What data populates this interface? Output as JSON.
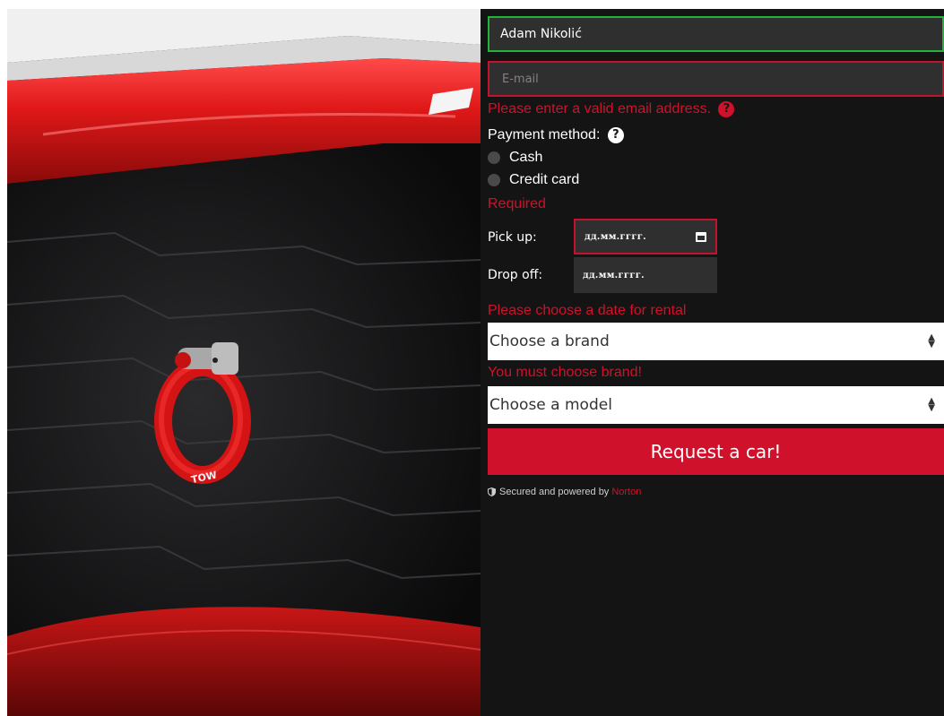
{
  "form": {
    "name_value": "Adam Nikolić",
    "email_placeholder": "E-mail",
    "email_error": "Please enter a valid email address.",
    "payment_label": "Payment method:",
    "payment_options": [
      "Cash",
      "Credit card"
    ],
    "payment_error": "Required",
    "pickup_label": "Pick up:",
    "dropoff_label": "Drop off:",
    "pickup_value": "дд.мм.гггг.",
    "dropoff_value": "дд.мм.гггг.",
    "date_error": "Please choose a date for rental",
    "brand_select": "Choose a brand",
    "brand_error": "You must choose brand!",
    "model_select": "Choose a model",
    "submit_label": "Request a car!",
    "secured_text": "Secured and powered by",
    "secured_brand": "Norton"
  },
  "photo": {
    "tow_label": "TOW"
  },
  "colors": {
    "accent": "#d0112b",
    "valid": "#22b33a",
    "panel_bg": "#141414",
    "input_bg": "#2f2f2f"
  }
}
